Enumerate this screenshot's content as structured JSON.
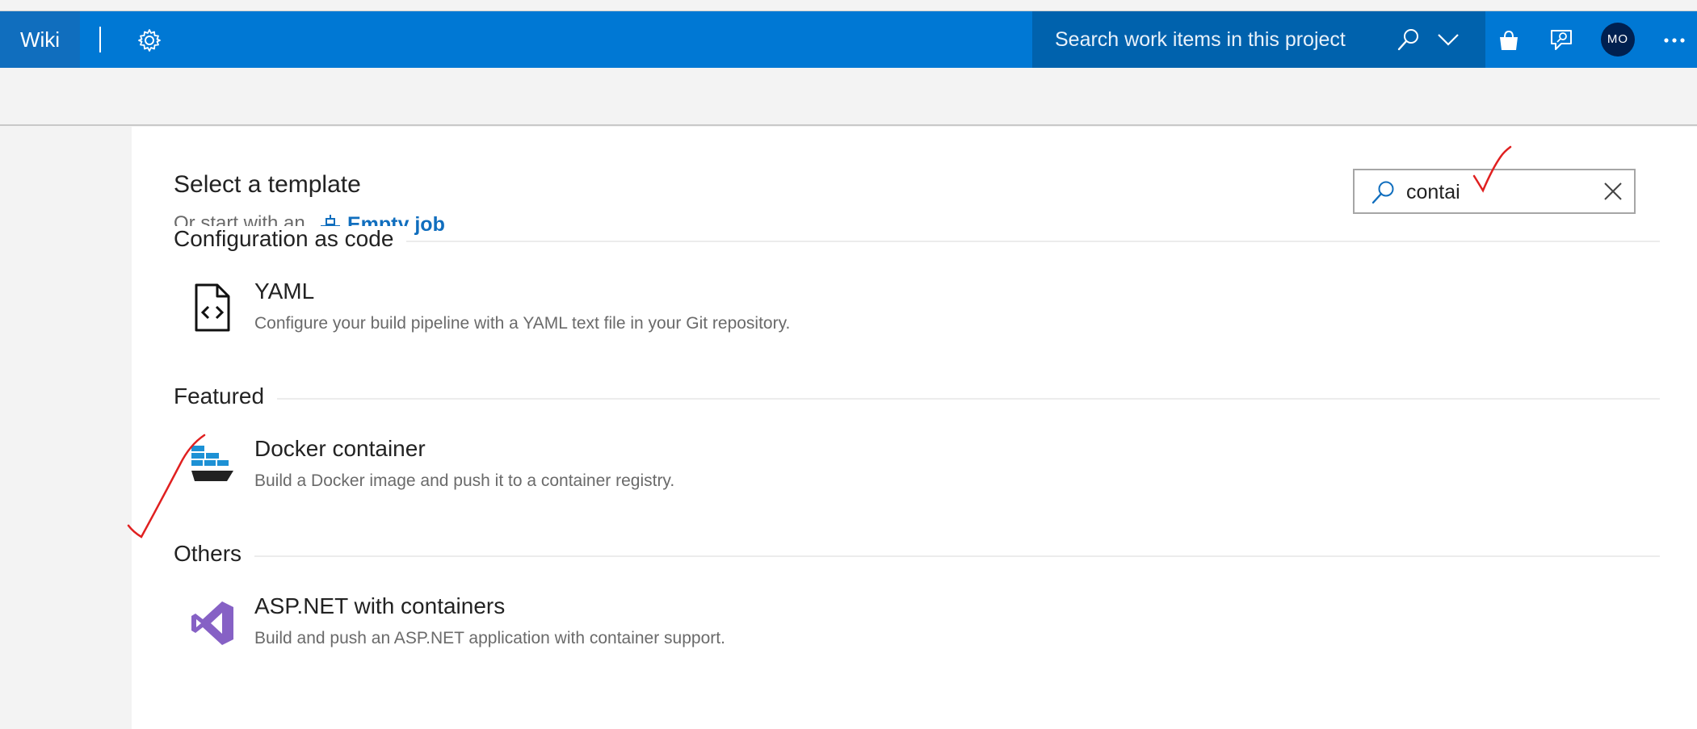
{
  "topbar": {
    "wiki_label": "Wiki",
    "search_placeholder": "Search work items in this project",
    "avatar_initials": "MO",
    "icons": [
      "gear-icon",
      "search-icon",
      "chevron-down-icon",
      "shopping-bag-icon",
      "feedback-icon",
      "more-icon"
    ],
    "colors": {
      "bar": "#0078d4",
      "search_bg": "#0062ad",
      "avatar": "#002050"
    }
  },
  "main": {
    "title": "Select a template",
    "start_prefix": "Or start with an",
    "empty_job_label": "Empty job",
    "filter": {
      "value": "contai"
    },
    "sections": [
      {
        "label": "Configuration as code",
        "items": [
          {
            "name": "YAML",
            "description": "Configure your build pipeline with a YAML text file in your Git repository.",
            "icon": "yaml-file-icon"
          }
        ]
      },
      {
        "label": "Featured",
        "items": [
          {
            "name": "Docker container",
            "description": "Build a Docker image and push it to a container registry.",
            "icon": "docker-icon"
          }
        ]
      },
      {
        "label": "Others",
        "items": [
          {
            "name": "ASP.NET with containers",
            "description": "Build and push an ASP.NET application with container support.",
            "icon": "visual-studio-icon"
          }
        ]
      }
    ],
    "link_color": "#106ebe",
    "annotation_color": "#e02020"
  }
}
